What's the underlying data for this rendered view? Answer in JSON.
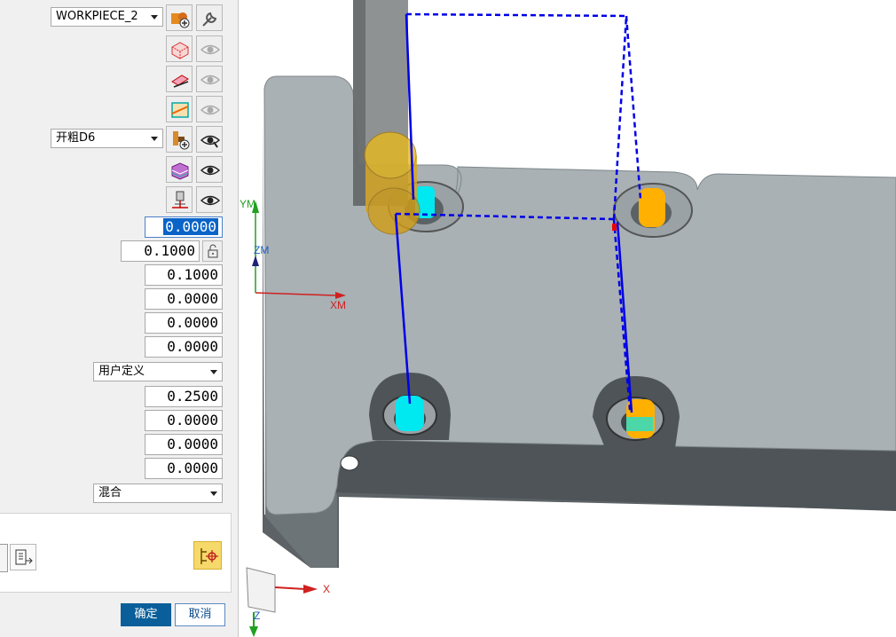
{
  "panel": {
    "geometry_select": "WORKPIECE_2",
    "tool_select": "开粗D6",
    "active_value": "0.0000",
    "row2_value": "0.1000",
    "values_a": [
      "0.1000",
      "0.0000",
      "0.0000",
      "0.0000"
    ],
    "mode_select": "用户定义",
    "values_b": [
      "0.2500",
      "0.0000",
      "0.0000",
      "0.0000"
    ],
    "blend_select": "混合"
  },
  "footer": {
    "ok_label": "确定",
    "cancel_label": "取消"
  },
  "viewport": {
    "axis_ym": "YM",
    "axis_zm": "ZM",
    "axis_xm": "XM",
    "axis_x": "X",
    "axis_z": "Z"
  },
  "colors": {
    "accent": "#0a5f9a",
    "part_top": "#a8b0b5",
    "part_side": "#555b5e",
    "toolpath": "#0000e6",
    "tool_yellow": "#e6b81e",
    "hole_cyan": "#00e8f0",
    "hole_orange": "#ffb000"
  }
}
